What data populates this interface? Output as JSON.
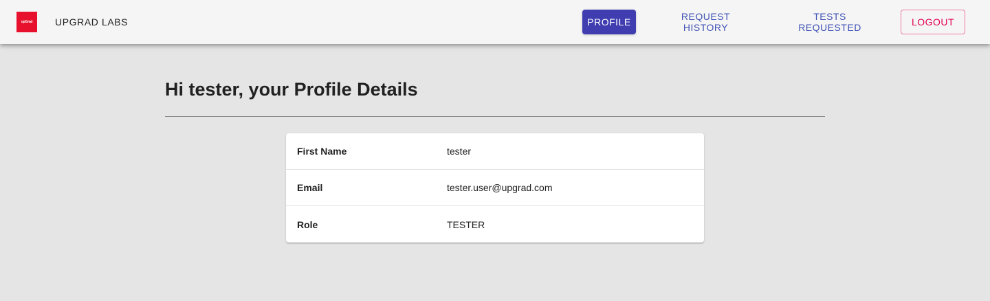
{
  "header": {
    "logo_text": "upGrad",
    "brand": "UPGRAD LABS",
    "nav": {
      "profile": "PROFILE",
      "request_history": "REQUEST HISTORY",
      "tests_requested": "TESTS REQUESTED",
      "logout": "LOGOUT"
    }
  },
  "main": {
    "title": "Hi tester, your Profile Details",
    "profile_rows": [
      {
        "label": "First Name",
        "value": "tester"
      },
      {
        "label": "Email",
        "value": "tester.user@upgrad.com"
      },
      {
        "label": "Role",
        "value": "TESTER"
      }
    ]
  },
  "colors": {
    "primary": "#3f3db0",
    "link": "#3f51b5",
    "secondary": "#e10050",
    "logo": "#e8112d"
  }
}
